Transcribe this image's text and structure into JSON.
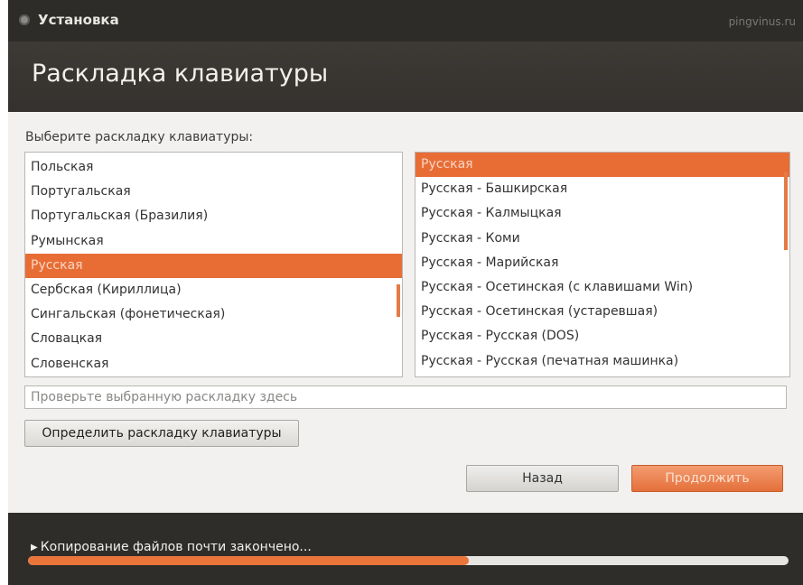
{
  "window": {
    "title": "Установка",
    "watermark": "pingvinus.ru"
  },
  "header": {
    "title": "Раскладка клавиатуры"
  },
  "main": {
    "prompt": "Выберите раскладку клавиатуры:",
    "layouts": [
      {
        "label": "Польская",
        "selected": false
      },
      {
        "label": "Португальская",
        "selected": false
      },
      {
        "label": "Португальская (Бразилия)",
        "selected": false
      },
      {
        "label": "Румынская",
        "selected": false
      },
      {
        "label": "Русская",
        "selected": true
      },
      {
        "label": "Сербская (Кириллица)",
        "selected": false
      },
      {
        "label": "Сингальская (фонетическая)",
        "selected": false
      },
      {
        "label": "Словацкая",
        "selected": false
      },
      {
        "label": "Словенская",
        "selected": false
      }
    ],
    "variants": [
      {
        "label": "Русская",
        "selected": true
      },
      {
        "label": "Русская - Башкирская",
        "selected": false
      },
      {
        "label": "Русская - Калмыцкая",
        "selected": false
      },
      {
        "label": "Русская - Коми",
        "selected": false
      },
      {
        "label": "Русская - Марийская",
        "selected": false
      },
      {
        "label": "Русская - Осетинская (с клавишами Win)",
        "selected": false
      },
      {
        "label": "Русская - Осетинская (устаревшая)",
        "selected": false
      },
      {
        "label": "Русская - Русская (DOS)",
        "selected": false
      },
      {
        "label": "Русская - Русская (печатная машинка)",
        "selected": false
      }
    ],
    "test_input": {
      "placeholder": "Проверьте выбранную раскладку здесь",
      "value": ""
    },
    "detect_button": "Определить раскладку клавиатуры",
    "back_button": "Назад",
    "continue_button": "Продолжить"
  },
  "footer": {
    "status": "Копирование файлов почти закончено...",
    "progress_percent": 58
  },
  "colors": {
    "accent": "#e86d35",
    "dark": "#2f2d2a"
  }
}
